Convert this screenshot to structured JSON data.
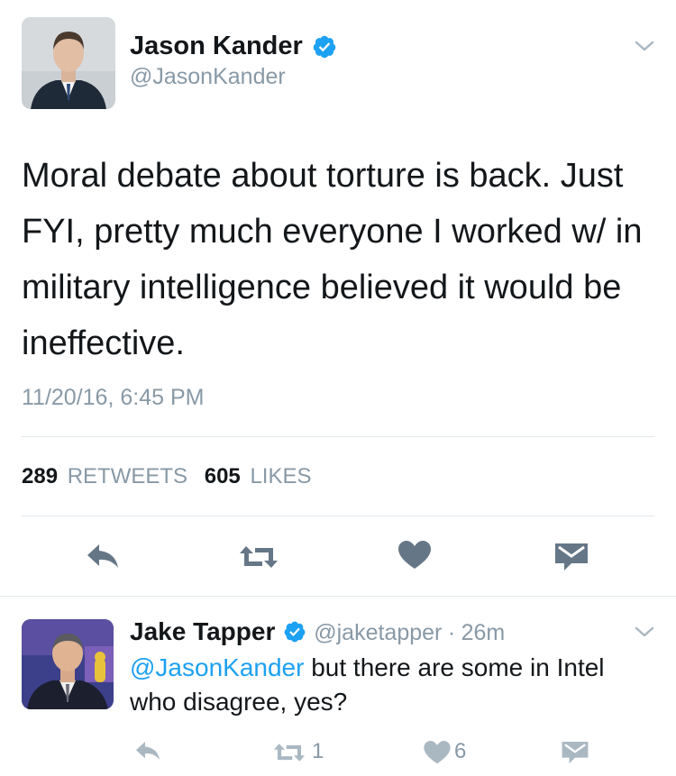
{
  "tweet": {
    "author_name": "Jason Kander",
    "author_handle": "@JasonKander",
    "text": "Moral debate about torture is back. Just FYI, pretty much everyone I worked w/ in military intelligence believed it would be ineffective.",
    "timestamp": "11/20/16, 6:45 PM",
    "retweets_count": "289",
    "retweets_label": "RETWEETS",
    "likes_count": "605",
    "likes_label": "LIKES"
  },
  "reply": {
    "author_name": "Jake Tapper",
    "author_handle": "@jaketapper",
    "separator": "·",
    "time": "26m",
    "mention": "@JasonKander",
    "text": " but there are some in Intel who disagree, yes?",
    "retweet_count": "1",
    "like_count": "6"
  },
  "colors": {
    "verified": "#1da1f2",
    "icon_gray": "#8899a6",
    "action_gray": "#657786",
    "link": "#1da1f2"
  },
  "icons": [
    "verified-icon",
    "chevron-down-icon",
    "reply-icon",
    "retweet-icon",
    "heart-icon",
    "dm-icon"
  ]
}
